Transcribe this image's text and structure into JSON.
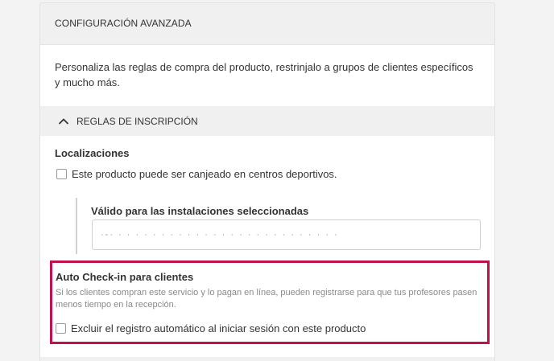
{
  "card": {
    "header_title": "CONFIGURACIÓN AVANZADA",
    "intro_text": "Personaliza las reglas de compra del producto, restrinjalo a grupos de clientes específicos y mucho más.",
    "section": {
      "title": "REGLAS DE INSCRIPCIÓN",
      "chevron_icon": "chevron-up-icon"
    },
    "locations": {
      "label": "Localizaciones",
      "checkbox_label": "Este producto puede ser canjeado en centros deportivos.",
      "checked": false,
      "facilities": {
        "label": "Válido para las instalaciones seleccionadas",
        "value": "·-·  ·  ·  ·  ·  ·  ·  ·  ·  ·  ·  ·  ·  ·  ·  ·  ·  ·  ·  ·  ·  ·  ·  ·  ·  ·  ·"
      }
    },
    "auto_checkin": {
      "label": "Auto Check-in para clientes",
      "help_text": "Si los clientes compran este servicio y lo pagan en línea, pueden registrarse para que tus profesores pasen menos tiempo en la recepción.",
      "checkbox_label": "Excluir el registro automático al iniciar sesión con este producto",
      "checked": false,
      "highlight_color": "#c0114b"
    }
  }
}
